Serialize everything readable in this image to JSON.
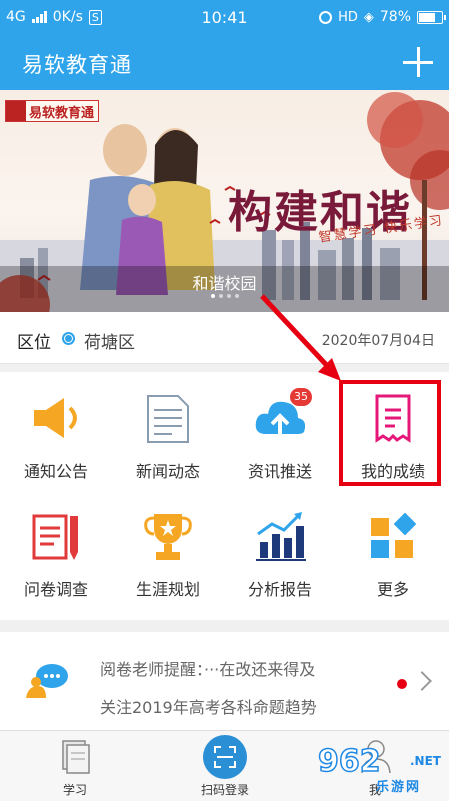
{
  "status_bar": {
    "network": "4G",
    "speed": "0K/s",
    "sim_badge": "S",
    "time": "10:41",
    "hd": "HD",
    "battery": "78%",
    "battery_level": 0.78
  },
  "app_bar": {
    "title": "易软教育通",
    "add_icon": "plus-icon"
  },
  "banner": {
    "logo_text": "易软教育通",
    "headline": "构建和谐",
    "slogan": "智慧学习 快乐学习",
    "caption": "和谐校园",
    "slide_count": 4,
    "active_slide": 1
  },
  "region": {
    "label": "区位",
    "value": "荷塘区",
    "date": "2020年07月04日"
  },
  "grid": [
    {
      "label": "通知公告",
      "icon": "megaphone-icon"
    },
    {
      "label": "新闻动态",
      "icon": "news-document-icon"
    },
    {
      "label": "资讯推送",
      "icon": "cloud-upload-icon",
      "badge": "35"
    },
    {
      "label": "我的成绩",
      "icon": "score-report-icon"
    },
    {
      "label": "问卷调查",
      "icon": "survey-pencil-icon"
    },
    {
      "label": "生涯规划",
      "icon": "trophy-icon"
    },
    {
      "label": "分析报告",
      "icon": "growth-chart-icon"
    },
    {
      "label": "更多",
      "icon": "more-grid-icon"
    }
  ],
  "notice": {
    "line1": "阅卷老师提醒：···在改还来得及",
    "line2": "关注2019年高考各科命题趋势"
  },
  "bottom_nav": [
    {
      "label": "学习",
      "icon": "book-stack-icon"
    },
    {
      "label": "扫码登录",
      "icon": "scan-icon"
    },
    {
      "label": "我",
      "icon": "profile-icon"
    }
  ],
  "watermark": {
    "number": "962",
    "domain": ".NET",
    "text": "乐游网"
  },
  "colors": {
    "primary": "#2fa4ea",
    "highlight": "#e60012",
    "badge": "#e53935"
  }
}
